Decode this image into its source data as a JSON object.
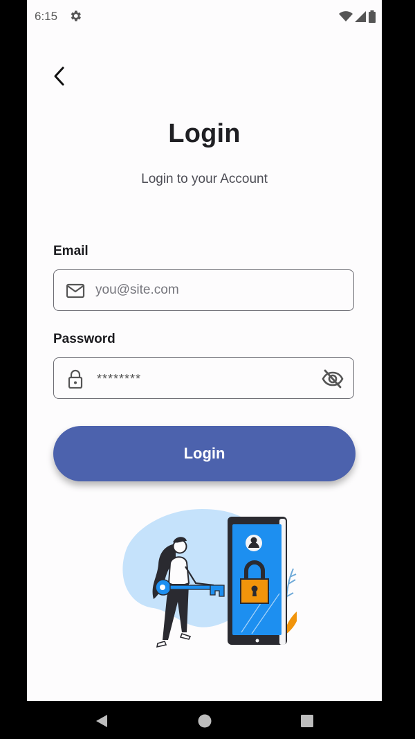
{
  "status_bar": {
    "time": "6:15",
    "icons": [
      "gear-icon",
      "wifi-icon",
      "signal-icon",
      "battery-icon"
    ]
  },
  "header": {
    "back_icon": "chevron-left-icon",
    "title": "Login",
    "subtitle": "Login to your Account"
  },
  "form": {
    "email": {
      "label": "Email",
      "placeholder": "you@site.com",
      "value": "",
      "icon": "mail-icon"
    },
    "password": {
      "label": "Password",
      "masked_value": "********",
      "icon": "lock-icon",
      "toggle_icon": "eye-off-icon"
    },
    "submit_label": "Login"
  },
  "illustration": {
    "name": "woman-with-key-and-phone-lock-illustration"
  },
  "nav_bar": {
    "items": [
      "back-icon",
      "home-icon",
      "recents-icon"
    ]
  },
  "colors": {
    "primary": "#4c62ad",
    "blob": "#c5e2fb",
    "phone_screen": "#1d8ff0",
    "lock": "#f1940b",
    "text_dark": "#1f1f23"
  }
}
